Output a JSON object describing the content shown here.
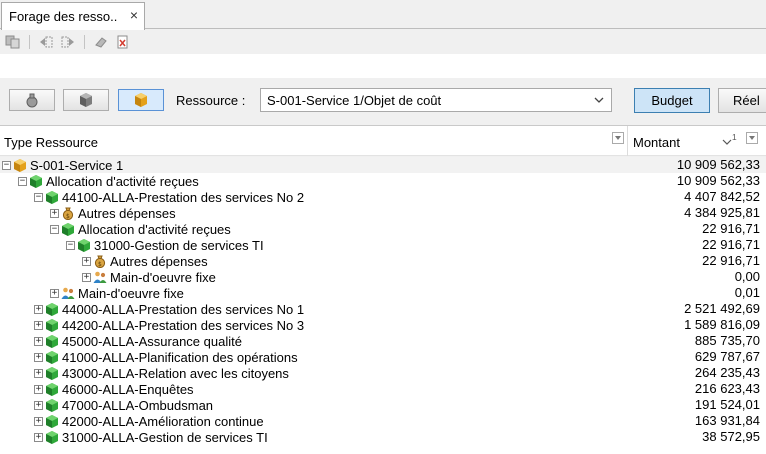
{
  "tab": {
    "title": "Forage des resso..",
    "close": "×"
  },
  "toolbar": {
    "resource_label": "Ressource :",
    "resource_value": "S-001-Service 1/Objet de coût",
    "budget_label": "Budget",
    "reel_label": "Réel"
  },
  "grid": {
    "col_type": "Type Ressource",
    "col_montant": "Montant",
    "sort_order": "1"
  },
  "rows": [
    {
      "level": 0,
      "expander": "−",
      "icon": "cube-icon",
      "label": "S-001-Service 1",
      "amount": "10 909 562,33"
    },
    {
      "level": 1,
      "expander": "−",
      "icon": "green-cube-icon",
      "label": "Allocation d'activité reçues",
      "amount": "10 909 562,33"
    },
    {
      "level": 2,
      "expander": "−",
      "icon": "green-cube-icon",
      "label": "44100-ALLA-Prestation des services No 2",
      "amount": "4 407 842,52"
    },
    {
      "level": 3,
      "expander": "+",
      "icon": "money-bag-icon",
      "label": "Autres dépenses",
      "amount": "4 384 925,81"
    },
    {
      "level": 3,
      "expander": "−",
      "icon": "green-cube-icon",
      "label": "Allocation d'activité reçues",
      "amount": "22 916,71"
    },
    {
      "level": 4,
      "expander": "−",
      "icon": "green-cube-icon",
      "label": "31000-Gestion de services TI",
      "amount": "22 916,71"
    },
    {
      "level": 5,
      "expander": "+",
      "icon": "money-bag-icon",
      "label": "Autres dépenses",
      "amount": "22 916,71"
    },
    {
      "level": 5,
      "expander": "+",
      "icon": "people-icon",
      "label": "Main-d'oeuvre fixe",
      "amount": "0,00"
    },
    {
      "level": 3,
      "expander": "+",
      "icon": "people-icon",
      "label": "Main-d'oeuvre fixe",
      "amount": "0,01"
    },
    {
      "level": 2,
      "expander": "+",
      "icon": "green-cube-icon",
      "label": "44000-ALLA-Prestation des services No 1",
      "amount": "2 521 492,69"
    },
    {
      "level": 2,
      "expander": "+",
      "icon": "green-cube-icon",
      "label": "44200-ALLA-Prestation des services No 3",
      "amount": "1 589 816,09"
    },
    {
      "level": 2,
      "expander": "+",
      "icon": "green-cube-icon",
      "label": "45000-ALLA-Assurance qualité",
      "amount": "885 735,70"
    },
    {
      "level": 2,
      "expander": "+",
      "icon": "green-cube-icon",
      "label": "41000-ALLA-Planification des opérations",
      "amount": "629 787,67"
    },
    {
      "level": 2,
      "expander": "+",
      "icon": "green-cube-icon",
      "label": "43000-ALLA-Relation avec les citoyens",
      "amount": "264 235,43"
    },
    {
      "level": 2,
      "expander": "+",
      "icon": "green-cube-icon",
      "label": "46000-ALLA-Enquêtes",
      "amount": "216 623,43"
    },
    {
      "level": 2,
      "expander": "+",
      "icon": "green-cube-icon",
      "label": "47000-ALLA-Ombudsman",
      "amount": "191 524,01"
    },
    {
      "level": 2,
      "expander": "+",
      "icon": "green-cube-icon",
      "label": "42000-ALLA-Amélioration continue",
      "amount": "163 931,84"
    },
    {
      "level": 2,
      "expander": "+",
      "icon": "green-cube-icon",
      "label": "31000-ALLA-Gestion de services TI",
      "amount": "38 572,95"
    }
  ],
  "colors": {
    "selection": "#cde4f7",
    "green": "#2fa83a",
    "orange": "#f2a81d"
  }
}
